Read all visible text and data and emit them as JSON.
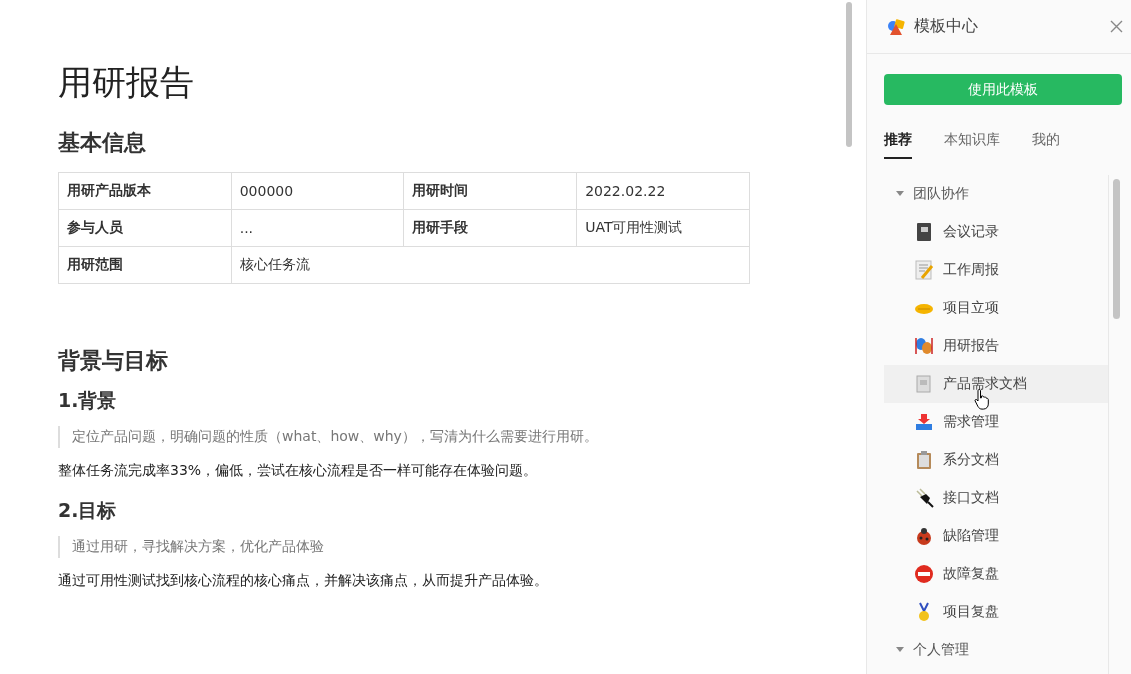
{
  "document": {
    "title": "用研报告",
    "sections": [
      {
        "heading": "基本信息",
        "fields": [
          [
            {
              "label": "用研产品版本",
              "value": "000000"
            },
            {
              "label": "用研时间",
              "value": "2022.02.22"
            }
          ],
          [
            {
              "label": "参与人员",
              "value": "..."
            },
            {
              "label": "用研手段",
              "value": "UAT可用性测试"
            }
          ],
          [
            {
              "label": "用研范围",
              "value": "核心任务流"
            }
          ]
        ]
      },
      {
        "heading": "背景与目标",
        "subsections": [
          {
            "heading": "1.背景",
            "quote": "定位产品问题，明确问题的性质（what、how、why），写清为什么需要进行用研。",
            "body": "整体任务流完成率33%，偏低，尝试在核心流程是否一样可能存在体验问题。"
          },
          {
            "heading": "2.目标",
            "quote": "通过用研，寻找解决方案，优化产品体验",
            "body": "通过可用性测试找到核心流程的核心痛点，并解决该痛点，从而提升产品体验。"
          }
        ]
      }
    ]
  },
  "template_panel": {
    "title": "模板中心",
    "use_button": "使用此模板",
    "tabs": [
      {
        "label": "推荐",
        "selected": true
      },
      {
        "label": "本知识库",
        "selected": false
      },
      {
        "label": "我的",
        "selected": false
      }
    ],
    "tree": [
      {
        "label": "团队协作",
        "expanded": true,
        "children": [
          {
            "label": "会议记录",
            "hovered": false
          },
          {
            "label": "工作周报",
            "hovered": false
          },
          {
            "label": "项目立项",
            "hovered": false
          },
          {
            "label": "用研报告",
            "hovered": false
          },
          {
            "label": "产品需求文档",
            "hovered": true
          },
          {
            "label": "需求管理",
            "hovered": false
          },
          {
            "label": "系分文档",
            "hovered": false
          },
          {
            "label": "接口文档",
            "hovered": false
          },
          {
            "label": "缺陷管理",
            "hovered": false
          },
          {
            "label": "故障复盘",
            "hovered": false
          },
          {
            "label": "项目复盘",
            "hovered": false
          }
        ]
      },
      {
        "label": "个人管理",
        "expanded": true
      }
    ]
  }
}
